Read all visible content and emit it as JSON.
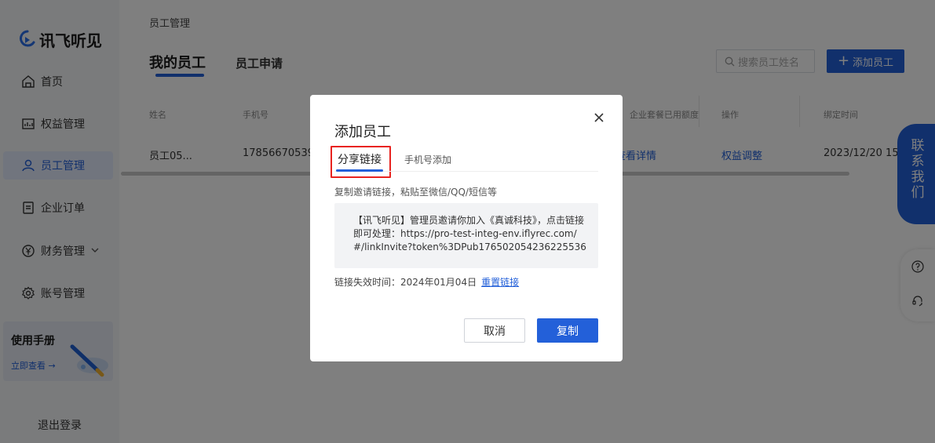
{
  "app": {
    "logo_text": "讯飞听见"
  },
  "sidebar": {
    "items": [
      {
        "label": "首页",
        "icon": "home-icon"
      },
      {
        "label": "权益管理",
        "icon": "chart-icon"
      },
      {
        "label": "员工管理",
        "icon": "user-icon",
        "active": true
      },
      {
        "label": "企业订单",
        "icon": "document-icon"
      },
      {
        "label": "财务管理",
        "icon": "yen-icon",
        "has_dropdown": true
      },
      {
        "label": "账号管理",
        "icon": "gear-icon"
      }
    ],
    "manual": {
      "title": "使用手册",
      "link": "立即查看 →"
    },
    "logout": "退出登录"
  },
  "main": {
    "breadcrumb": "员工管理",
    "tabs": [
      {
        "label": "我的员工",
        "active": true
      },
      {
        "label": "员工申请"
      }
    ],
    "search": {
      "placeholder": "搜索员工姓名"
    },
    "add_button": "添加员工",
    "table": {
      "columns": [
        "姓名",
        "手机号",
        "企业套餐已用额度",
        "操作",
        "绑定时间"
      ],
      "row": {
        "name": "员工05...",
        "phone": "17856670539",
        "quota_action": "查看详情",
        "action": "权益调整",
        "bind_time": "2023/12/20 15"
      }
    }
  },
  "floating": {
    "contact_chars": [
      "联",
      "系",
      "我",
      "们"
    ]
  },
  "modal": {
    "title": "添加员工",
    "tabs": [
      {
        "label": "分享链接",
        "active": true
      },
      {
        "label": "手机号添加"
      }
    ],
    "copy_hint": "复制邀请链接，粘贴至微信/QQ/短信等",
    "invite_text": "【讯飞听见】管理员邀请你加入《真诚科技》，点击链接即可处理：https://pro-test-integ-env.iflyrec.com/#/linkInvite?token%3DPub176502054236225536",
    "expire_label": "链接失效时间：2024年01月04日",
    "reset_link": "重置链接",
    "cancel": "取消",
    "copy": "复制"
  },
  "colors": {
    "primary": "#2360d9",
    "highlight_box": "#e8231f",
    "overlay": "rgba(0,0,0,0.5)"
  }
}
